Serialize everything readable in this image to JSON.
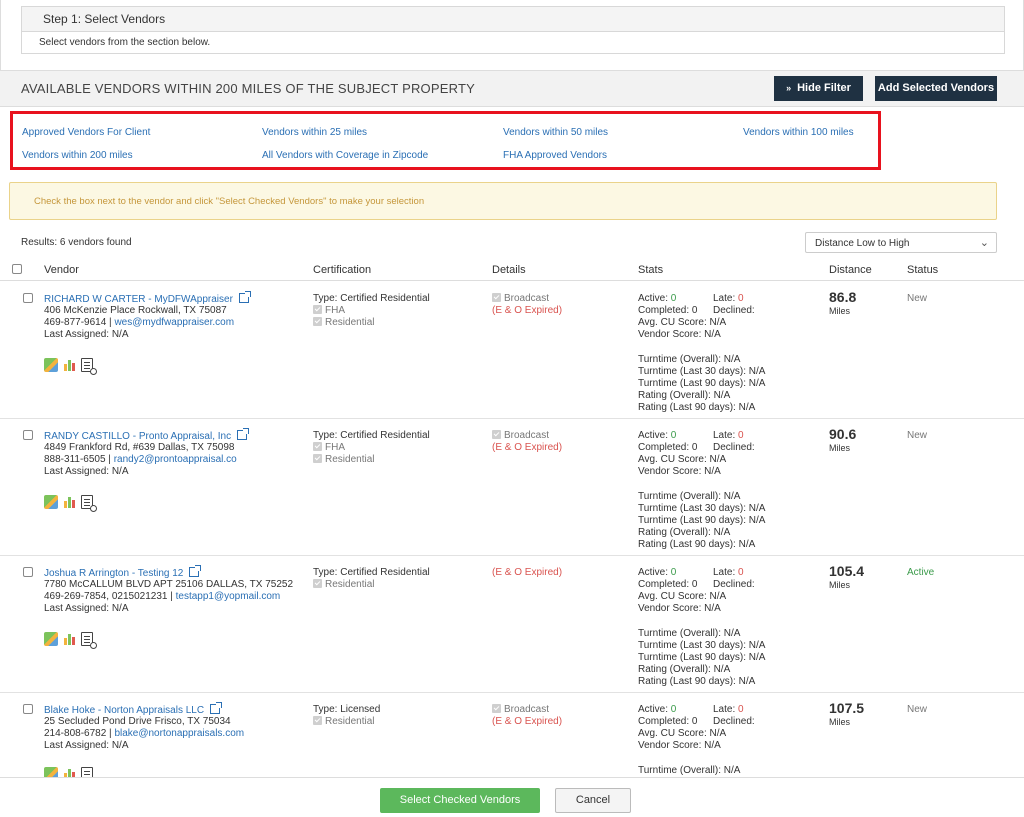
{
  "step": {
    "title": "Step 1: Select Vendors",
    "subtitle": "Select vendors from the section below."
  },
  "available": {
    "title": "AVAILABLE VENDORS WITHIN 200 MILES OF THE SUBJECT PROPERTY",
    "hide_filter": "Hide Filter",
    "add_selected": "Add Selected Vendors",
    "hide_filter_icon": "double-chevron-down-icon"
  },
  "filters": [
    "Approved Vendors For Client",
    "Vendors within 25 miles",
    "Vendors within 50 miles",
    "Vendors within 100 miles",
    "Vendors within 200 miles",
    "All Vendors with Coverage in Zipcode",
    "FHA Approved Vendors"
  ],
  "hint": "Check the box next to the vendor and click \"Select Checked Vendors\" to make your selection",
  "results_text": "Results: 6 vendors found",
  "sort": {
    "selected": "Distance Low to High"
  },
  "columns": {
    "vendor": "Vendor",
    "certification": "Certification",
    "details": "Details",
    "stats": "Stats",
    "distance": "Distance",
    "status": "Status"
  },
  "labels": {
    "active": "Active:",
    "late": "Late:",
    "completed": "Completed:",
    "declined": "Declined:",
    "avg_cu": "Avg. CU Score: N/A",
    "vendor_score": "Vendor Score: N/A",
    "turn_overall": "Turntime (Overall): N/A",
    "turn_30": "Turntime (Last 30 days): N/A",
    "turn_90": "Turntime (Last 90 days): N/A",
    "rating_overall": "Rating (Overall): N/A",
    "rating_90": "Rating (Last 90 days): N/A",
    "miles": "Miles",
    "broadcast": "Broadcast",
    "eo_expired": "(E & O Expired)",
    "last_assigned": "Last Assigned: N/A"
  },
  "vendors": [
    {
      "name": "RICHARD W CARTER - MyDFWAppraiser",
      "address": "406 McKenzie Place Rockwall, TX 75087",
      "phone": "469-877-9614 | ",
      "email": "wes@mydfwappraiser.com",
      "cert_type": "Type: Certified Residential",
      "certs": [
        "FHA",
        "Residential"
      ],
      "active": "0",
      "late": "0",
      "completed": "0",
      "distance": "86.8",
      "status": "New"
    },
    {
      "name": "RANDY CASTILLO - Pronto Appraisal, Inc",
      "address": "4849 Frankford Rd, #639 Dallas, TX 75098",
      "phone": "888-311-6505 | ",
      "email": "randy2@prontoappraisal.co",
      "cert_type": "Type: Certified Residential",
      "certs": [
        "FHA",
        "Residential"
      ],
      "active": "0",
      "late": "0",
      "completed": "0",
      "distance": "90.6",
      "status": "New"
    },
    {
      "name": "Joshua R Arrington - Testing 12",
      "address": "7780 McCALLUM BLVD APT 25106 DALLAS, TX 75252",
      "phone": "469-269-7854, 0215021231 | ",
      "email": "testapp1@yopmail.com",
      "cert_type": "Type: Certified Residential",
      "certs": [
        "Residential"
      ],
      "active": "0",
      "late": "0",
      "completed": "0",
      "distance": "105.4",
      "status": "Active"
    },
    {
      "name": "Blake Hoke - Norton Appraisals LLC",
      "address": "25 Secluded Pond Drive Frisco, TX 75034",
      "phone": "214-808-6782 | ",
      "email": "blake@nortonappraisals.com",
      "cert_type": "Type: Licensed",
      "certs": [
        "Residential"
      ],
      "active": "0",
      "late": "0",
      "completed": "0",
      "distance": "107.5",
      "status": "New"
    }
  ],
  "footer": {
    "select_checked": "Select Checked Vendors",
    "cancel": "Cancel"
  },
  "colors": {
    "link": "#2a6fb4",
    "dark_button": "#1f3142",
    "green_button": "#5cb85c",
    "highlight": "#e8121e",
    "error": "#d9534f",
    "active_status": "#3a9a4a"
  }
}
